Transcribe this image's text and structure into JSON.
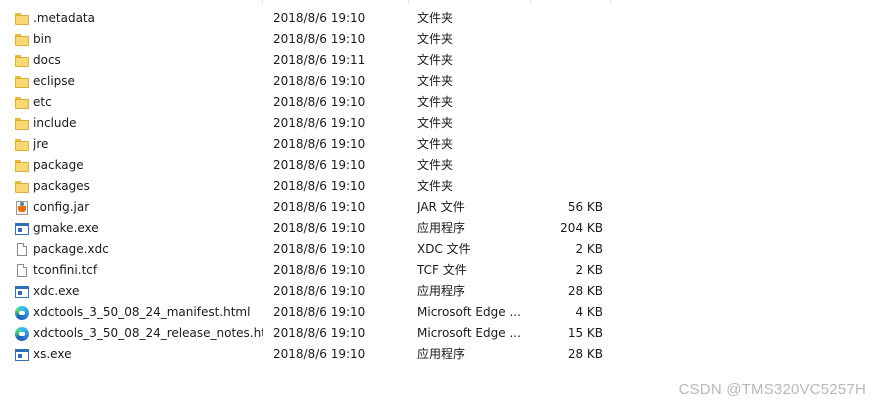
{
  "files": [
    {
      "name": ".metadata",
      "date": "2018/8/6 19:10",
      "type": "文件夹",
      "size": "",
      "icon": "folder-icon"
    },
    {
      "name": "bin",
      "date": "2018/8/6 19:10",
      "type": "文件夹",
      "size": "",
      "icon": "folder-icon"
    },
    {
      "name": "docs",
      "date": "2018/8/6 19:11",
      "type": "文件夹",
      "size": "",
      "icon": "folder-icon"
    },
    {
      "name": "eclipse",
      "date": "2018/8/6 19:10",
      "type": "文件夹",
      "size": "",
      "icon": "folder-icon"
    },
    {
      "name": "etc",
      "date": "2018/8/6 19:10",
      "type": "文件夹",
      "size": "",
      "icon": "folder-icon"
    },
    {
      "name": "include",
      "date": "2018/8/6 19:10",
      "type": "文件夹",
      "size": "",
      "icon": "folder-icon"
    },
    {
      "name": "jre",
      "date": "2018/8/6 19:10",
      "type": "文件夹",
      "size": "",
      "icon": "folder-icon"
    },
    {
      "name": "package",
      "date": "2018/8/6 19:10",
      "type": "文件夹",
      "size": "",
      "icon": "folder-icon"
    },
    {
      "name": "packages",
      "date": "2018/8/6 19:10",
      "type": "文件夹",
      "size": "",
      "icon": "folder-icon"
    },
    {
      "name": "config.jar",
      "date": "2018/8/6 19:10",
      "type": "JAR 文件",
      "size": "56 KB",
      "icon": "jar-file-icon"
    },
    {
      "name": "gmake.exe",
      "date": "2018/8/6 19:10",
      "type": "应用程序",
      "size": "204 KB",
      "icon": "exe-icon"
    },
    {
      "name": "package.xdc",
      "date": "2018/8/6 19:10",
      "type": "XDC 文件",
      "size": "2 KB",
      "icon": "document-icon"
    },
    {
      "name": "tconfini.tcf",
      "date": "2018/8/6 19:10",
      "type": "TCF 文件",
      "size": "2 KB",
      "icon": "document-icon"
    },
    {
      "name": "xdc.exe",
      "date": "2018/8/6 19:10",
      "type": "应用程序",
      "size": "28 KB",
      "icon": "exe-icon"
    },
    {
      "name": "xdctools_3_50_08_24_manifest.html",
      "date": "2018/8/6 19:10",
      "type": "Microsoft Edge ...",
      "size": "4 KB",
      "icon": "edge-icon"
    },
    {
      "name": "xdctools_3_50_08_24_release_notes.ht...",
      "date": "2018/8/6 19:10",
      "type": "Microsoft Edge ...",
      "size": "15 KB",
      "icon": "edge-icon"
    },
    {
      "name": "xs.exe",
      "date": "2018/8/6 19:10",
      "type": "应用程序",
      "size": "28 KB",
      "icon": "exe-icon"
    }
  ],
  "watermark": "CSDN @TMS320VC5257H",
  "colors": {
    "folder": "#f8d775",
    "exe": "#2f6fb7",
    "watermark": "#b8b8b8"
  }
}
